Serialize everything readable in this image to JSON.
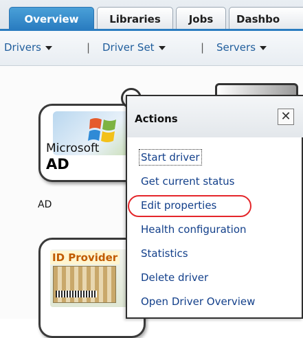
{
  "tabs": [
    {
      "label": "Overview",
      "active": true
    },
    {
      "label": "Libraries",
      "active": false
    },
    {
      "label": "Jobs",
      "active": false
    },
    {
      "label": "Dashbo",
      "active": false
    }
  ],
  "subnav": {
    "items": [
      "Drivers",
      "Driver Set",
      "Servers"
    ],
    "separator": "|"
  },
  "canvas": {
    "ad_driver": {
      "title": "Microsoft",
      "subtitle": "AD",
      "label": "AD"
    },
    "idp_driver": {
      "title": "ID Provider"
    }
  },
  "popup": {
    "title": "Actions",
    "close_glyph": "✕",
    "actions": [
      "Start driver",
      "Get current status",
      "Edit properties",
      "Health configuration",
      "Statistics",
      "Delete driver",
      "Open Driver Overview"
    ],
    "highlighted_action": "Edit properties",
    "highlight_color": "#e4262a"
  },
  "colors": {
    "active_tab": "#2a7cc0",
    "link": "#123f8a",
    "nav_link": "#1f5d9c"
  }
}
